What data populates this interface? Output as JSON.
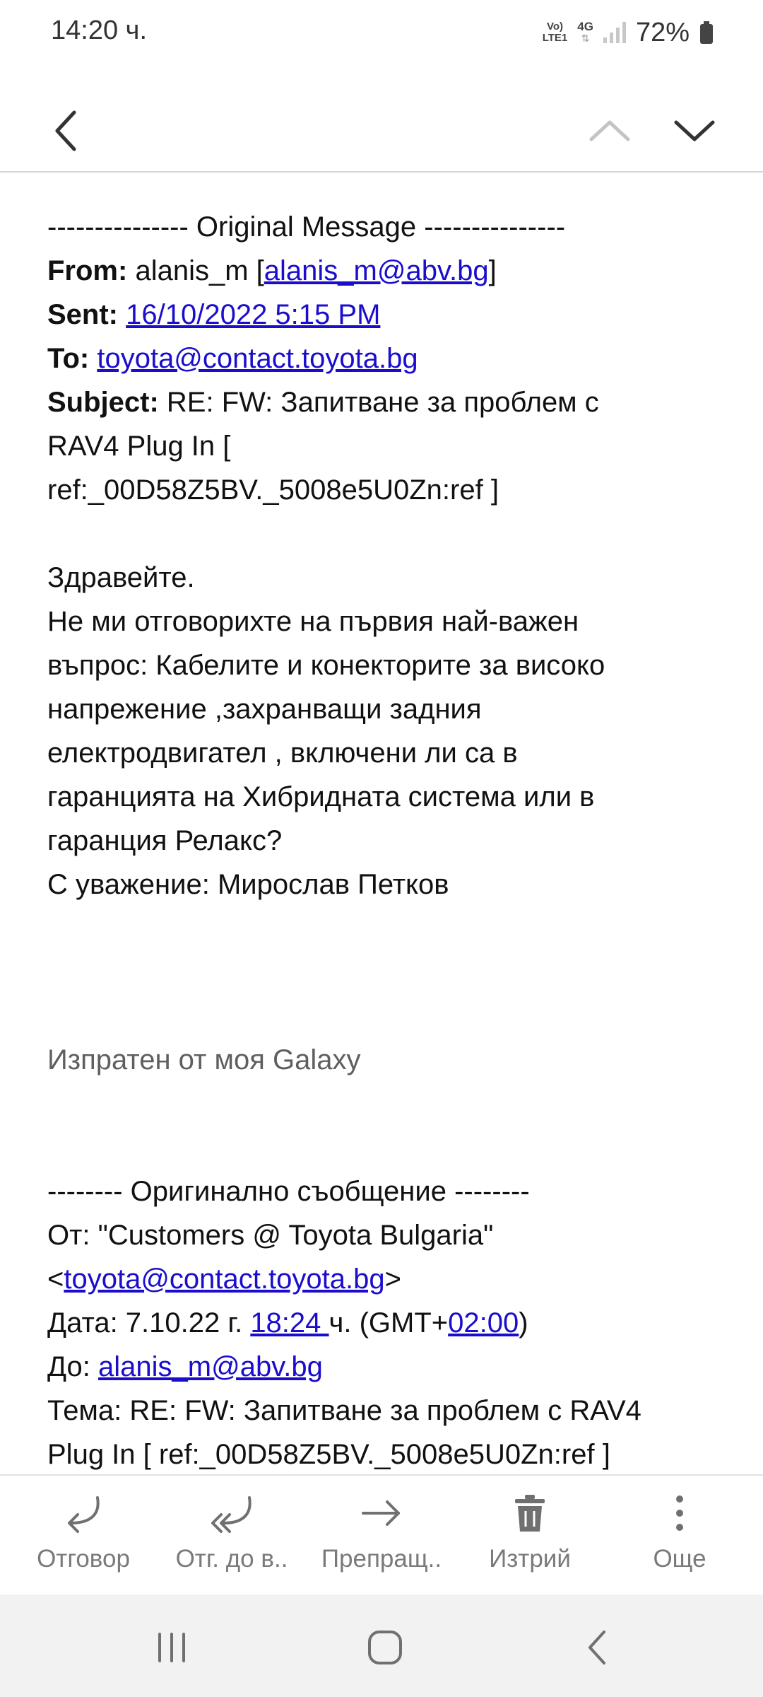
{
  "status": {
    "time": "14:20 ч.",
    "volte_top": "Vo)",
    "volte_bottom": "LTE1",
    "network": "4G",
    "battery": "72%"
  },
  "toolbar": {
    "back_icon": "chevron-left-icon",
    "prev_icon": "chevron-up-icon",
    "next_icon": "chevron-down-icon"
  },
  "email": {
    "orig_header": "--------------- Original Message ---------------",
    "from_label": "From:",
    "from_name": "alanis_m [",
    "from_email": "alanis_m@abv.bg",
    "from_close": "]",
    "sent_label": "Sent:",
    "sent_value": "16/10/2022 5:15 PM",
    "to_label": "To:",
    "to_value": "toyota@contact.toyota.bg",
    "subject_label": "Subject:",
    "subject_line1": "RE: FW: Запитване за проблем с",
    "subject_line2": "RAV4 Plug In [",
    "subject_line3": "ref:_00D58Z5BV._5008e5U0Zn:ref ]",
    "body_lines": [
      "Здравейте.",
      "Не ми отговорихте на първия най-важен",
      "въпрос: Кабелите и конекторите за високо",
      "напрежение ,захранващи задния",
      "електродвигател , включени ли са в",
      "гаранцията на Хибридната система или в",
      "гаранция Релакс?",
      "С уважение: Мирослав Петков"
    ],
    "signature": "Изпратен от моя Galaxy",
    "orig2_header": "-------- Оригинално съобщение --------",
    "orig2_from_line1": "От: \"Customers @ Toyota Bulgaria\"",
    "orig2_from_open": "<",
    "orig2_from_email": "toyota@contact.toyota.bg",
    "orig2_from_close": ">",
    "orig2_date_prefix": "Дата: 7.10.22 г. ",
    "orig2_date_time": "18:24 ",
    "orig2_date_mid": "ч. (GMT+",
    "orig2_date_tz": "02:00",
    "orig2_date_end": ")",
    "orig2_to_label": "До: ",
    "orig2_to_email": "alanis_m@abv.bg",
    "orig2_subject_line1": "Тема: RE: FW: Запитване за проблем с RAV4",
    "orig2_subject_line2": "Plug In [ ref:_00D58Z5BV._5008e5U0Zn:ref ]"
  },
  "actions": {
    "reply": {
      "label": "Отговор",
      "icon": "reply-icon"
    },
    "reply_all": {
      "label": "Отг. до в..",
      "icon": "reply-all-icon"
    },
    "forward": {
      "label": "Препращ..",
      "icon": "forward-icon"
    },
    "delete": {
      "label": "Изтрий",
      "icon": "trash-icon"
    },
    "more": {
      "label": "Още",
      "icon": "more-vertical-icon"
    }
  },
  "colors": {
    "link": "#1a0dcc",
    "icon": "#707070",
    "nav_bg": "#f2f2f2"
  }
}
